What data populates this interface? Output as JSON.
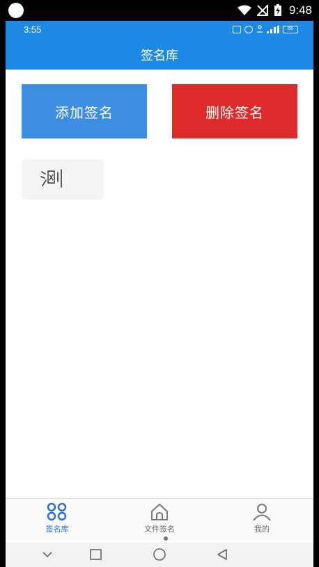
{
  "device_status": {
    "time": "9:48"
  },
  "app_status": {
    "time": "3:55",
    "battery": "66"
  },
  "header": {
    "title": "签名库"
  },
  "actions": {
    "add_label": "添加签名",
    "delete_label": "删除签名"
  },
  "signatures": [
    {
      "text": "测"
    }
  ],
  "tabs": [
    {
      "label": "签名库",
      "icon": "grid-icon",
      "active": true
    },
    {
      "label": "文件签名",
      "icon": "home-icon",
      "active": false
    },
    {
      "label": "我的",
      "icon": "user-icon",
      "active": false
    }
  ],
  "colors": {
    "primary": "#1e88e5",
    "add_button": "#3d8de3",
    "delete_button": "#dd2a2a",
    "active_tab": "#1e6fd0"
  }
}
